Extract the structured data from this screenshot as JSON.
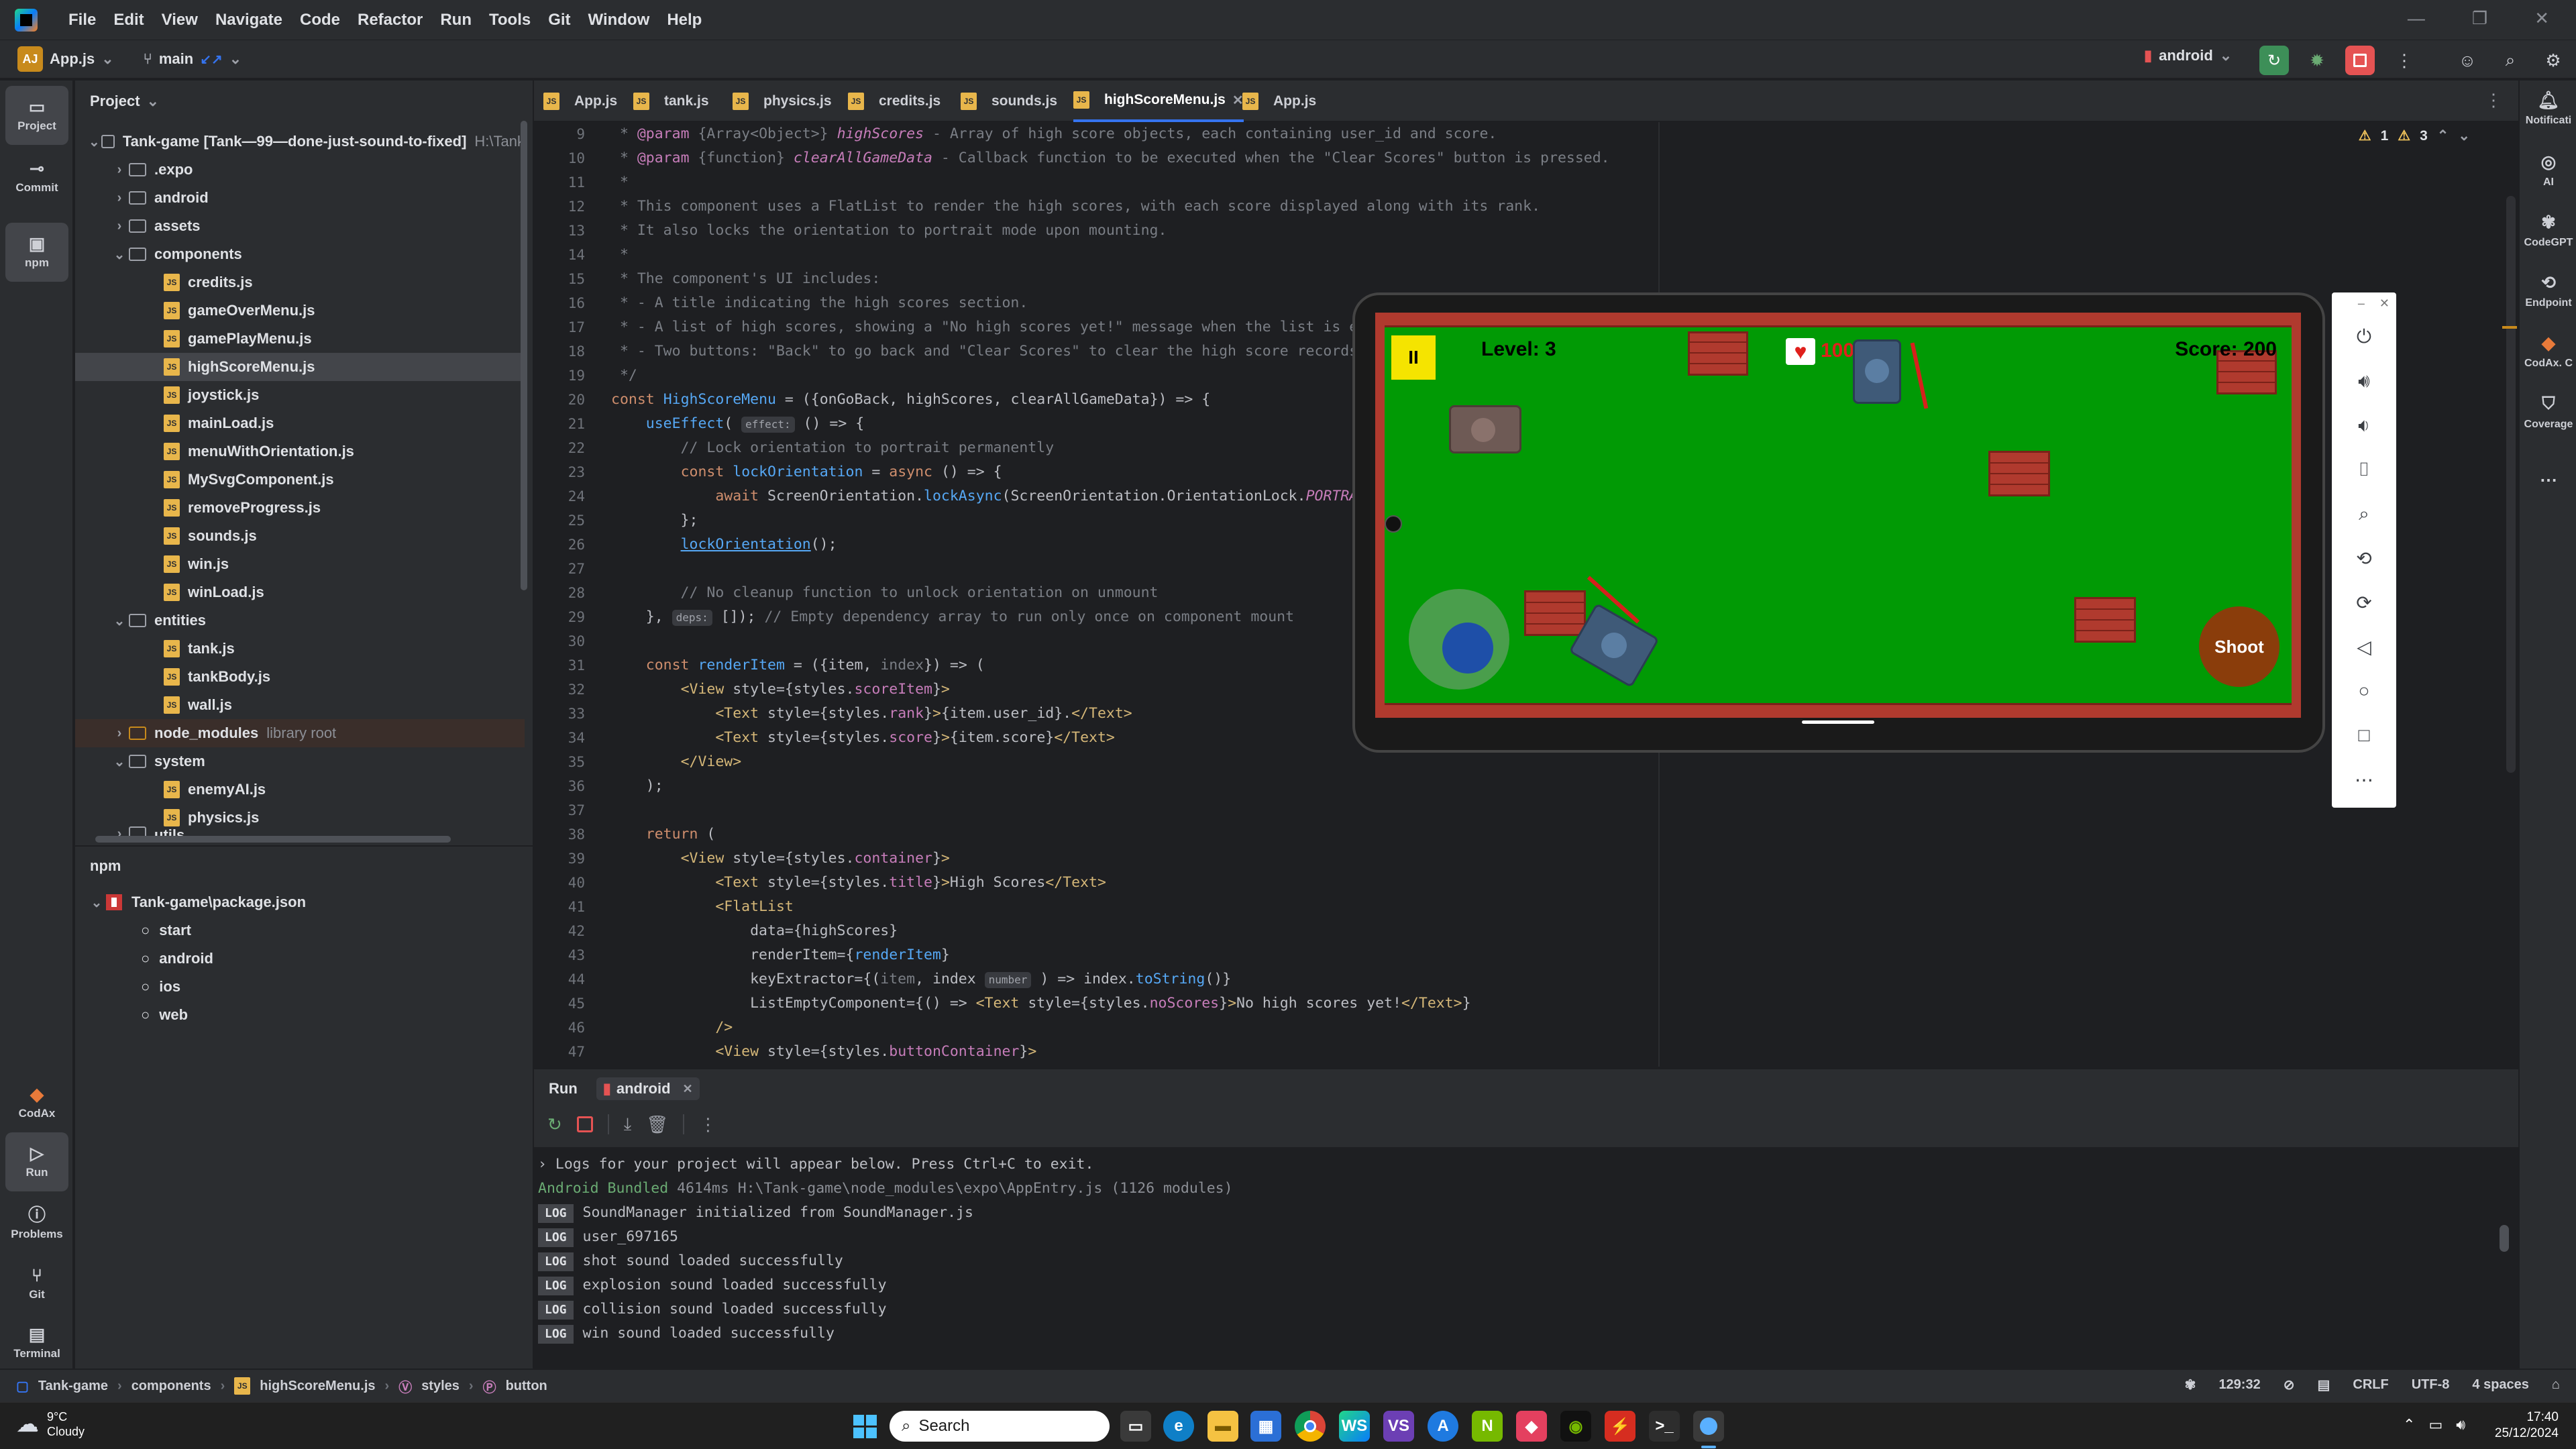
{
  "menubar": {
    "items": [
      "File",
      "Edit",
      "View",
      "Navigate",
      "Code",
      "Refactor",
      "Run",
      "Tools",
      "Git",
      "Window",
      "Help"
    ]
  },
  "toolbar": {
    "project_badge": "AJ",
    "project_file": "App.js",
    "branch": "main",
    "run_config": "android"
  },
  "left_tools": {
    "project": "Project",
    "commit": "Commit",
    "npm": "npm",
    "codax": "CodAx",
    "run": "Run",
    "problems": "Problems",
    "git": "Git",
    "terminal": "Terminal"
  },
  "project_pane": {
    "title": "Project",
    "root": "Tank-game [Tank—99—done-just-sound-to-fixed]",
    "root_path": "H:\\Tank",
    "items": [
      {
        "label": ".expo"
      },
      {
        "label": "android"
      },
      {
        "label": "assets"
      },
      {
        "label": "components"
      },
      {
        "label": "credits.js"
      },
      {
        "label": "gameOverMenu.js"
      },
      {
        "label": "gamePlayMenu.js"
      },
      {
        "label": "highScoreMenu.js"
      },
      {
        "label": "joystick.js"
      },
      {
        "label": "mainLoad.js"
      },
      {
        "label": "menuWithOrientation.js"
      },
      {
        "label": "MySvgComponent.js"
      },
      {
        "label": "removeProgress.js"
      },
      {
        "label": "sounds.js"
      },
      {
        "label": "win.js"
      },
      {
        "label": "winLoad.js"
      },
      {
        "label": "entities"
      },
      {
        "label": "tank.js"
      },
      {
        "label": "tankBody.js"
      },
      {
        "label": "wall.js"
      },
      {
        "label": "node_modules"
      },
      {
        "label": "system"
      },
      {
        "label": "enemyAI.js"
      },
      {
        "label": "physics.js"
      },
      {
        "label": "utils"
      }
    ],
    "library_root": "library root"
  },
  "npm_pane": {
    "title": "npm",
    "package": "Tank-game\\package.json",
    "scripts": [
      "start",
      "android",
      "ios",
      "web"
    ]
  },
  "editor_tabs": [
    "App.js",
    "tank.js",
    "physics.js",
    "credits.js",
    "sounds.js",
    "highScoreMenu.js",
    "App.js"
  ],
  "editor": {
    "warnings": "1",
    "weak_warnings": "3",
    "line_numbers": [
      "9",
      "10",
      "11",
      "12",
      "13",
      "14",
      "15",
      "16",
      "17",
      "18",
      "19",
      "20",
      "21",
      "22",
      "23",
      "24",
      "25",
      "26",
      "27",
      "28",
      "29",
      "30",
      "31",
      "32",
      "33",
      "34",
      "35",
      "36",
      "37",
      "38",
      "39",
      "40",
      "41",
      "42",
      "43",
      "44",
      "45",
      "46",
      "47"
    ],
    "hints": {
      "effect": "effect:",
      "deps": "deps:",
      "number": "number"
    }
  },
  "game": {
    "level": "Level: 3",
    "health": "100",
    "score": "Score: 200",
    "shoot": "Shoot",
    "pause": "II"
  },
  "run_pane": {
    "tab_run": "Run",
    "tab_config": "android",
    "logs": [
      {
        "kind": "info",
        "text": "› Logs for your project will appear below. Press Ctrl+C to exit."
      },
      {
        "kind": "bundled",
        "prefix": "Android Bundled",
        "text": " 4614ms H:\\Tank-game\\node_modules\\expo\\AppEntry.js (1126 modules)"
      },
      {
        "kind": "log",
        "badge": "LOG",
        "text": "SoundManager initialized from SoundManager.js"
      },
      {
        "kind": "log",
        "badge": "LOG",
        "text": "user_697165"
      },
      {
        "kind": "log",
        "badge": "LOG",
        "text": "shot sound loaded successfully"
      },
      {
        "kind": "log",
        "badge": "LOG",
        "text": "explosion sound loaded successfully"
      },
      {
        "kind": "log",
        "badge": "LOG",
        "text": "collision sound loaded successfully"
      },
      {
        "kind": "log",
        "badge": "LOG",
        "text": "win sound loaded successfully"
      }
    ]
  },
  "right_tools": [
    "Notificati",
    "AI",
    "CodeGPT",
    "Endpoint",
    "CodAx. C",
    "Coverage"
  ],
  "statusbar": {
    "breadcrumb": [
      "Tank-game",
      "components",
      "highScoreMenu.js",
      "styles",
      "button"
    ],
    "position": "129:32",
    "line_sep": "CRLF",
    "encoding": "UTF-8",
    "indent": "4 spaces"
  },
  "taskbar": {
    "weather_temp": "9°C",
    "weather_desc": "Cloudy",
    "search": "Search",
    "time": "17:40",
    "date": "25/12/2024"
  },
  "colors": {
    "accent": "#3574f0",
    "run_green": "#3d8f58",
    "stop_red": "#e55353",
    "field_green": "#019a05",
    "brick": "#b03a2e"
  }
}
